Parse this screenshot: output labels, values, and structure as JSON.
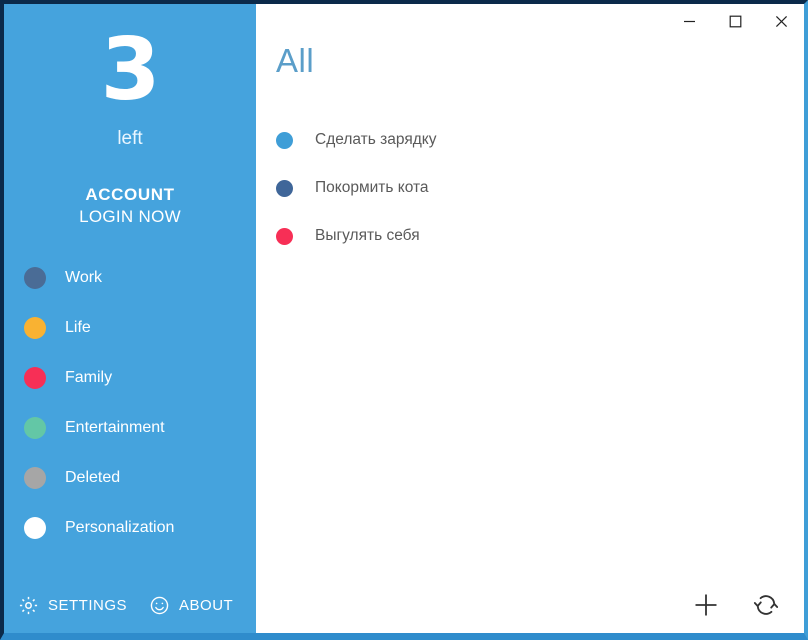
{
  "window": {
    "controls": [
      {
        "name": "minimize",
        "glyph": "minimize-icon"
      },
      {
        "name": "maximize",
        "glyph": "maximize-icon"
      },
      {
        "name": "close",
        "glyph": "close-icon"
      }
    ]
  },
  "sidebar": {
    "counter": "3",
    "counter_label": "left",
    "account_title": "ACCOUNT",
    "account_action": "LOGIN NOW",
    "background": "#45a3dd",
    "categories": [
      {
        "label": "Work",
        "color": "#4a6c96"
      },
      {
        "label": "Life",
        "color": "#f9b232"
      },
      {
        "label": "Family",
        "color": "#f72f56"
      },
      {
        "label": "Entertainment",
        "color": "#63c7a6"
      },
      {
        "label": "Deleted",
        "color": "#a6a6a6"
      },
      {
        "label": "Personalization",
        "color": "#ffffff"
      }
    ],
    "footer": [
      {
        "label": "SETTINGS",
        "icon": "gear-icon"
      },
      {
        "label": "ABOUT",
        "icon": "smiley-icon"
      }
    ]
  },
  "main": {
    "title": "All",
    "title_color": "#5b9ec9",
    "tasks": [
      {
        "title": "Сделать зарядку",
        "color": "#3f9ed7"
      },
      {
        "title": "Покормить кота",
        "color": "#3f6699"
      },
      {
        "title": "Выгулять себя",
        "color": "#f72f56"
      }
    ],
    "actions": [
      {
        "name": "add",
        "icon": "plus-icon"
      },
      {
        "name": "refresh",
        "icon": "refresh-icon"
      }
    ]
  }
}
